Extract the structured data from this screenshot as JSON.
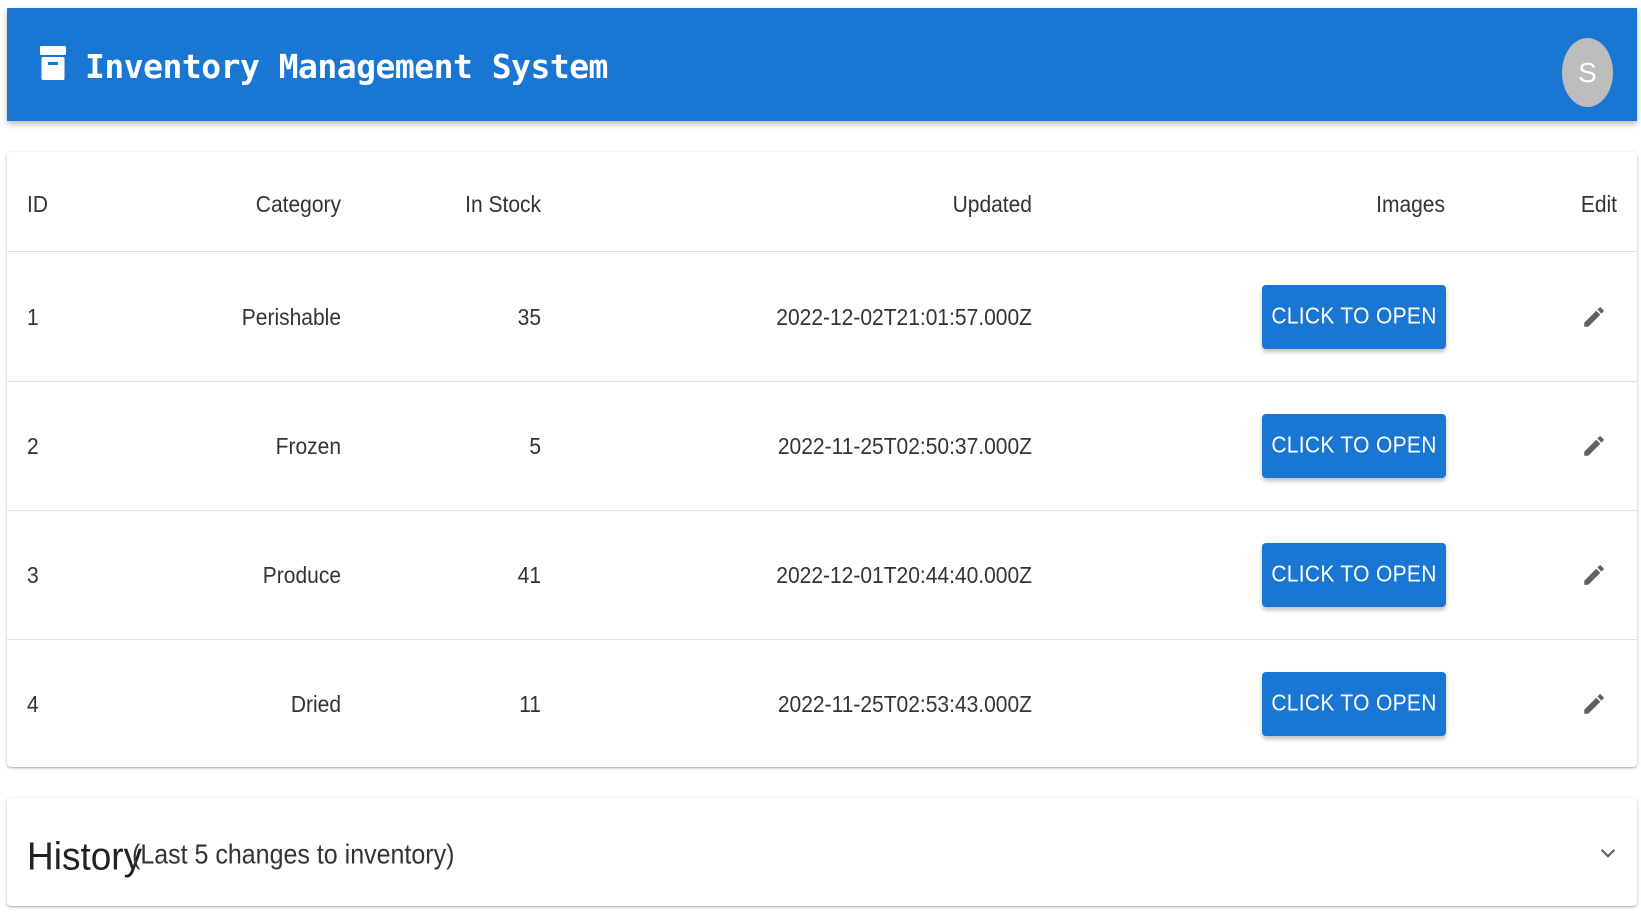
{
  "appbar": {
    "title": "Inventory Management System",
    "brand_icon": "inventory-icon",
    "avatar_letter": "S",
    "bar_color": "#1976d2",
    "avatar_color": "#bdbdbd"
  },
  "table": {
    "columns": [
      "ID",
      "Category",
      "In Stock",
      "Updated",
      "Images",
      "Edit"
    ],
    "rows": [
      {
        "id": "1",
        "category": "Perishable",
        "in_stock": "35",
        "updated": "2022-12-02T21:01:57.000Z",
        "images_button": "CLICK TO OPEN",
        "edit_icon": "pencil-icon"
      },
      {
        "id": "2",
        "category": "Frozen",
        "in_stock": "5",
        "updated": "2022-11-25T02:50:37.000Z",
        "images_button": "CLICK TO OPEN",
        "edit_icon": "pencil-icon"
      },
      {
        "id": "3",
        "category": "Produce",
        "in_stock": "41",
        "updated": "2022-12-01T20:44:40.000Z",
        "images_button": "CLICK TO OPEN",
        "edit_icon": "pencil-icon"
      },
      {
        "id": "4",
        "category": "Dried",
        "in_stock": "11",
        "updated": "2022-11-25T02:53:43.000Z",
        "images_button": "CLICK TO OPEN",
        "edit_icon": "pencil-icon"
      }
    ]
  },
  "history": {
    "title": "History",
    "subtitle": "(Last 5 changes to inventory)",
    "expand_icon": "chevron-down-icon"
  }
}
